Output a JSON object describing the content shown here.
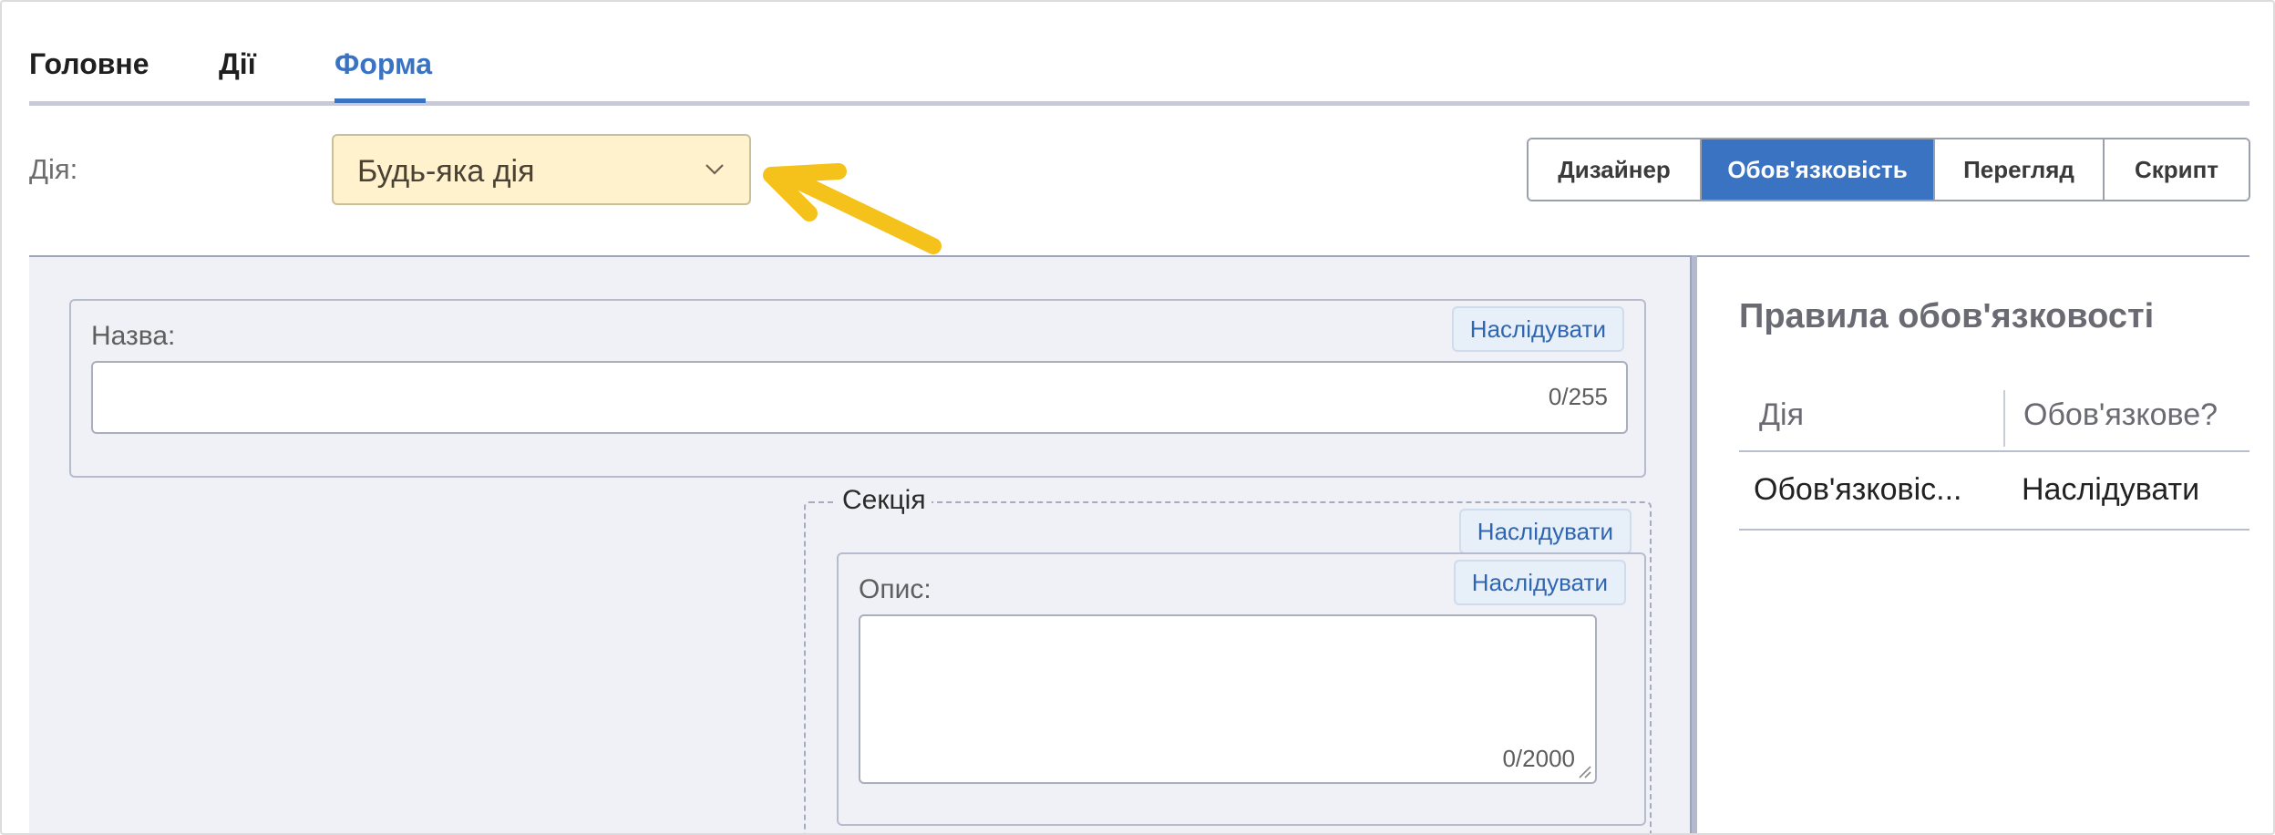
{
  "tabs": [
    {
      "label": "Головне"
    },
    {
      "label": "Дії"
    },
    {
      "label": "Форма"
    }
  ],
  "active_tab": "Форма",
  "action": {
    "label": "Дія:",
    "selected": "Будь-яка дія"
  },
  "view_modes": [
    {
      "label": "Дизайнер"
    },
    {
      "label": "Обов'язковість"
    },
    {
      "label": "Перегляд"
    },
    {
      "label": "Скрипт"
    }
  ],
  "active_view_mode": "Обов'язковість",
  "form": {
    "name_field": {
      "label": "Назва:",
      "inherit_label": "Наслідувати",
      "counter": "0/255"
    },
    "section": {
      "title": "Секція",
      "inherit_label": "Наслідувати",
      "description_field": {
        "label": "Опис:",
        "inherit_label": "Наслідувати",
        "counter": "0/2000"
      }
    }
  },
  "rules_panel": {
    "title": "Правила обов'язковості",
    "columns": [
      "Дія",
      "Обов'язкове?"
    ],
    "rows": [
      [
        "Обов'язковіс...",
        "Наслідувати"
      ]
    ]
  },
  "colors": {
    "accent": "#3a73c2",
    "highlight_select": "#fff2cc",
    "annotation_arrow": "#f5c21b",
    "canvas_bg": "#eff1f6"
  }
}
